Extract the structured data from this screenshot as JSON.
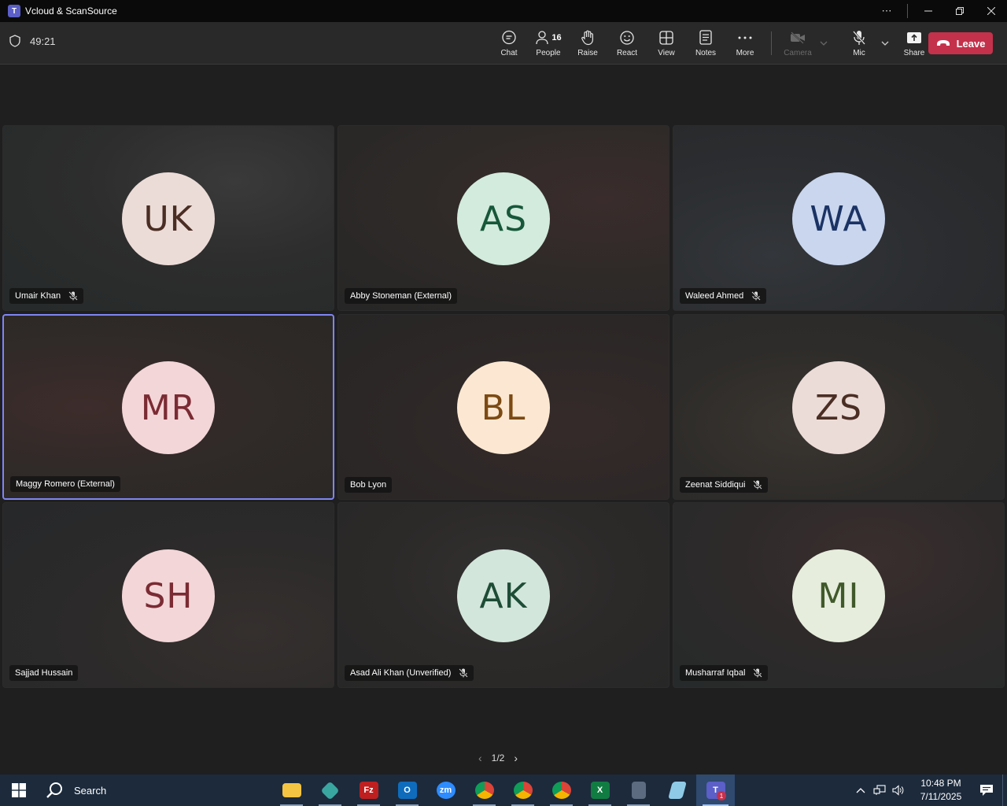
{
  "window": {
    "title": "Vcloud & ScanSource"
  },
  "meeting": {
    "timer": "49:21",
    "toolbar": {
      "chat": "Chat",
      "people": "People",
      "people_count": "16",
      "raise": "Raise",
      "react": "React",
      "view": "View",
      "notes": "Notes",
      "more": "More",
      "camera": "Camera",
      "mic": "Mic",
      "share": "Share",
      "leave": "Leave"
    },
    "participants": [
      {
        "initials": "UK",
        "name": "Umair Khan",
        "muted": true,
        "avatar_bg": "#ecdcd8",
        "avatar_fg": "#4a2e24",
        "active": false
      },
      {
        "initials": "AS",
        "name": "Abby Stoneman (External)",
        "muted": false,
        "avatar_bg": "#d2ebdc",
        "avatar_fg": "#17573a",
        "active": false
      },
      {
        "initials": "WA",
        "name": "Waleed Ahmed",
        "muted": true,
        "avatar_bg": "#c9d6ee",
        "avatar_fg": "#1b3364",
        "active": false
      },
      {
        "initials": "MR",
        "name": "Maggy Romero (External)",
        "muted": false,
        "avatar_bg": "#f3d6d8",
        "avatar_fg": "#7a2b33",
        "active": true
      },
      {
        "initials": "BL",
        "name": "Bob Lyon",
        "muted": false,
        "avatar_bg": "#fce8d2",
        "avatar_fg": "#7c4a13",
        "active": false
      },
      {
        "initials": "ZS",
        "name": "Zeenat Siddiqui",
        "muted": true,
        "avatar_bg": "#ecdcd8",
        "avatar_fg": "#4a2e24",
        "active": false
      },
      {
        "initials": "SH",
        "name": "Sajjad Hussain",
        "muted": false,
        "avatar_bg": "#f3d6d8",
        "avatar_fg": "#7a2b33",
        "active": false
      },
      {
        "initials": "AK",
        "name": "Asad Ali Khan (Unverified)",
        "muted": true,
        "avatar_bg": "#d3e6dc",
        "avatar_fg": "#1e4d36",
        "active": false
      },
      {
        "initials": "MI",
        "name": "Musharraf Iqbal",
        "muted": true,
        "avatar_bg": "#e6eddc",
        "avatar_fg": "#40592a",
        "active": false
      }
    ],
    "pagination": "1/2"
  },
  "taskbar": {
    "search": "Search",
    "apps": [
      "file-explorer",
      "app-diamond",
      "filezilla",
      "outlook",
      "zoom",
      "chrome",
      "chrome-profile-2",
      "chrome-profile-3",
      "excel",
      "calculator",
      "notepad",
      "teams"
    ],
    "teams_badge": "1",
    "time": "10:48 PM",
    "date": "7/11/2025"
  },
  "colors": {
    "leave": "#c4314b",
    "active_border": "#7f85f5",
    "taskbar": "#1c2a3c"
  }
}
